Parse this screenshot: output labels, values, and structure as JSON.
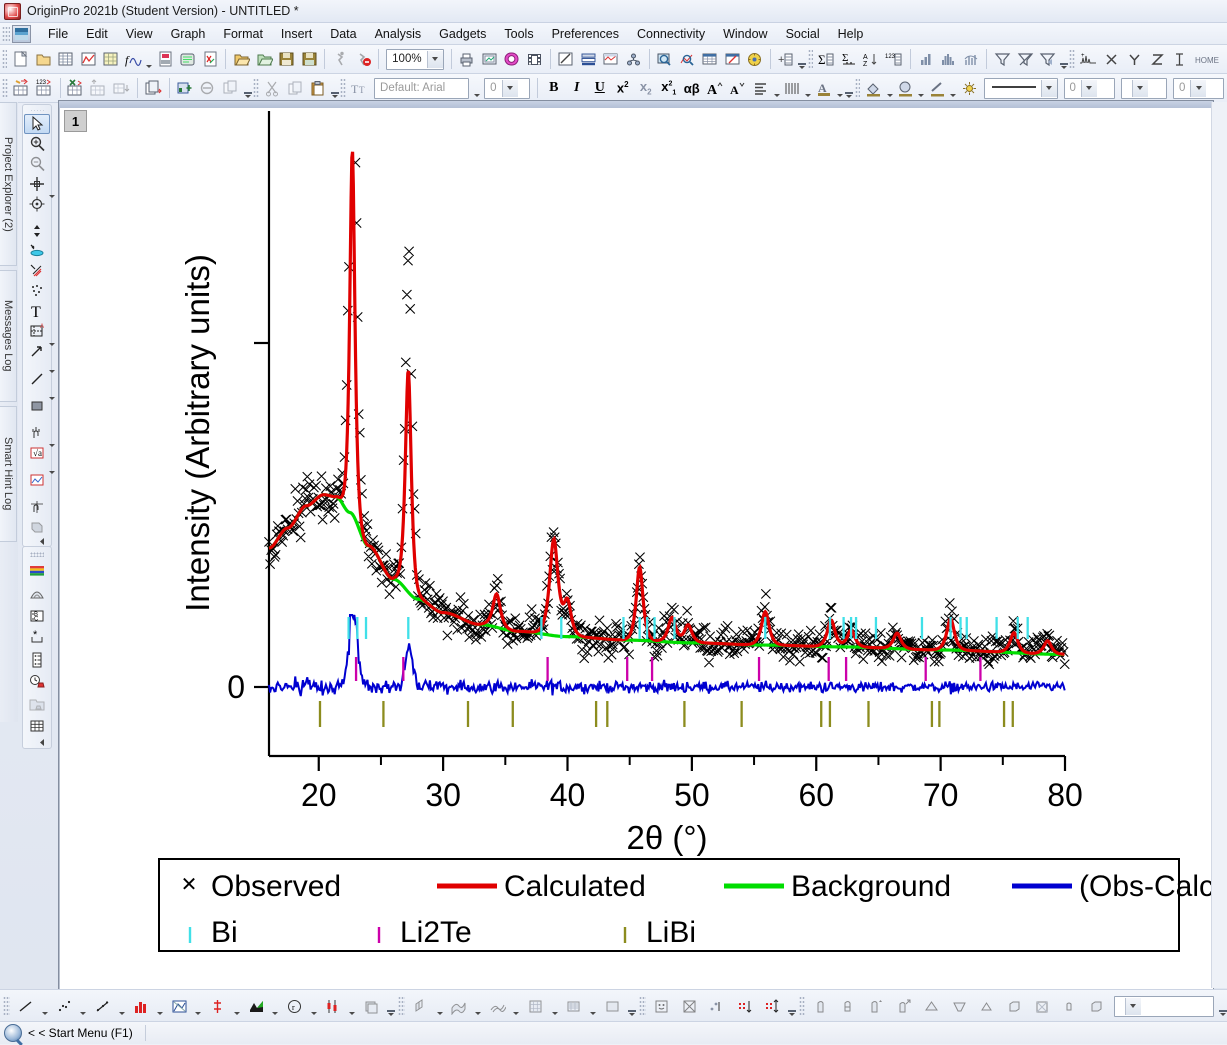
{
  "window": {
    "title": "OriginPro 2021b (Student Version) - UNTITLED *",
    "icon": "origin-logo-icon"
  },
  "menu": {
    "items": [
      {
        "label": "File"
      },
      {
        "label": "Edit"
      },
      {
        "label": "View"
      },
      {
        "label": "Graph"
      },
      {
        "label": "Format"
      },
      {
        "label": "Insert"
      },
      {
        "label": "Data"
      },
      {
        "label": "Analysis"
      },
      {
        "label": "Gadgets"
      },
      {
        "label": "Tools"
      },
      {
        "label": "Preferences"
      },
      {
        "label": "Connectivity"
      },
      {
        "label": "Window"
      },
      {
        "label": "Social"
      },
      {
        "label": "Help"
      }
    ]
  },
  "toolbar_standard": {
    "zoom_value": "100%",
    "buttons": [
      "new-project-icon",
      "new-folder-icon",
      "new-workbook-icon",
      "new-graph-icon",
      "new-matrix-icon",
      "new-function-plot-icon",
      "new-layout-icon",
      "new-notes-icon",
      "new-excel-icon",
      "open-icon",
      "open-excel-icon",
      "save-project-icon",
      "save-template-icon",
      "run-script-icon",
      "stop-script-icon",
      "print-icon",
      "print-preview-icon",
      "export-graph-icon",
      "movie-icon",
      "duplicate-icon",
      "merge-graph-icon",
      "extract-graph-icon",
      "layer-management-icon",
      "zoom-in-icon",
      "zoom-out-icon",
      "new-layout-table-icon",
      "edit-layer-icon",
      "theme-gallery-icon",
      "add-layer-icon",
      "sum-icon",
      "statistics-icon",
      "sort-icon",
      "count-icon",
      "column-chart-icon",
      "histogram-icon",
      "distribution-icon",
      "filter-icon",
      "remove-filter-icon",
      "reapply-filter-icon",
      "peak-analyzer-icon",
      "x-function-icon",
      "y-function-icon",
      "z-function-icon",
      "error-bar-icon",
      "home-icon"
    ]
  },
  "toolbar_format": {
    "font_name": "Default: Arial",
    "font_size": "0",
    "line_width_value": "0",
    "line_style_value": "0",
    "buttons": [
      "text-tool-icon",
      "bold-icon",
      "italic-icon",
      "underline-icon",
      "superscript-icon",
      "subscript-icon",
      "super-sub-icon",
      "greek-icon",
      "increase-font-icon",
      "decrease-font-icon",
      "align-icon",
      "line-pattern-icon",
      "font-color-icon",
      "fill-color-icon",
      "pattern-color-icon",
      "line-color-icon",
      "lighting-icon"
    ]
  },
  "toolbar_graph2": {
    "buttons": [
      "new-column-icon",
      "new-row-icon",
      "add-sheet-icon",
      "add-col-icon",
      "add-table-icon",
      "copy-page-icon",
      "add-plot-icon",
      "mask-icon",
      "duplicate-sheet-icon",
      "cut-icon",
      "copy-icon",
      "paste-icon"
    ]
  },
  "left_dock": {
    "tabs": [
      {
        "label": "Project Explorer (2)",
        "name": "project-explorer-tab"
      },
      {
        "label": "Messages Log",
        "name": "messages-log-tab"
      },
      {
        "label": "Smart Hint Log",
        "name": "smart-hint-log-tab"
      }
    ]
  },
  "tools_palette": {
    "items": [
      {
        "name": "pointer-tool",
        "selected": true
      },
      {
        "name": "zoom-in-tool",
        "selected": false
      },
      {
        "name": "zoom-out-tool",
        "selected": false
      },
      {
        "name": "screen-reader-tool",
        "selected": false
      },
      {
        "name": "data-reader-tool",
        "selected": false
      },
      {
        "name": "data-selector-tool",
        "selected": false
      },
      {
        "name": "data-highlighter-tool",
        "selected": false
      },
      {
        "name": "regional-mask-tool",
        "selected": false
      },
      {
        "name": "regional-data-select-tool",
        "selected": false
      },
      {
        "name": "draw-data-tool",
        "selected": false
      },
      {
        "name": "text-tool",
        "selected": false
      },
      {
        "name": "annotation-tool",
        "selected": false
      },
      {
        "name": "arrow-tool",
        "selected": false
      },
      {
        "name": "line-tool",
        "selected": false
      },
      {
        "name": "rectangle-tool",
        "selected": false
      },
      {
        "name": "scale-tool",
        "selected": false
      },
      {
        "name": "equation-tool",
        "selected": false
      },
      {
        "name": "graph-object-tool",
        "selected": false
      },
      {
        "name": "layer-drag-tool",
        "selected": false
      },
      {
        "name": "region-tool",
        "selected": false
      }
    ]
  },
  "style_palette": {
    "items": [
      {
        "name": "color-palette-tool"
      },
      {
        "name": "colormap-tool"
      },
      {
        "name": "rename-tool"
      },
      {
        "name": "asterisk-tool"
      },
      {
        "name": "table-style-tool"
      },
      {
        "name": "clock-stamp-tool"
      },
      {
        "name": "folder-export-tool"
      },
      {
        "name": "grid-tool"
      }
    ]
  },
  "graph": {
    "layer_label": "1"
  },
  "bottom_toolbar": {
    "groups": [
      [
        "line-plot-icon",
        "scatter-plot-icon",
        "line-symbol-icon",
        "column-plot-icon",
        "area-plot-icon",
        "high-low-close-icon",
        "fill-area-icon",
        "polar-plot-icon",
        "candlestick-icon",
        "stacked-icon"
      ],
      [
        "3d-bar-icon",
        "3d-surface-icon",
        "3d-waterfall-icon",
        "3d-matrix-icon",
        "contour-icon",
        "image-plot-icon"
      ],
      [
        "smiley-plot-icon",
        "ternary-plot-icon",
        "bubble-plot-icon",
        "vector-plot-icon",
        "xy-error-icon",
        "xyam-error-icon"
      ],
      [
        "3d-scatter-icon",
        "3d-trajectory-icon",
        "3d-vector-icon",
        "3d-vector-xyz-icon",
        "3d-cone-icon",
        "3d-funnel-icon",
        "3d-pyramid-icon",
        "3d-box-icon",
        "3d-wall-icon",
        "3d-parametric-icon",
        "3d-colormap-icon"
      ]
    ],
    "combo_value": ""
  },
  "status": {
    "text": "< < Start Menu (F1)",
    "icon": "start-menu-icon"
  },
  "chart_data": {
    "type": "line",
    "title": "",
    "xlabel": "2θ (°)",
    "ylabel": "Intensity (Arbitrary units)",
    "xlim": [
      16,
      80
    ],
    "ylim_label": "0",
    "xticks": [
      20,
      30,
      40,
      50,
      60,
      70,
      80
    ],
    "xminor_ticks": [
      25,
      35,
      45,
      55,
      65,
      75
    ],
    "yticks_labeled": [
      {
        "value": 0,
        "label": "0"
      }
    ],
    "grid": false,
    "legend_position": "below-axes",
    "series": [
      {
        "name": "Observed",
        "style": "scatter",
        "marker": "x",
        "color": "#000000"
      },
      {
        "name": "Calculated",
        "style": "line",
        "color": "#e00000"
      },
      {
        "name": "Background",
        "style": "line",
        "color": "#00dd00"
      },
      {
        "name": "(Obs-Calc)",
        "style": "line",
        "color": "#0000d0"
      },
      {
        "name": "Bi",
        "style": "ticks",
        "color": "#40e0e8"
      },
      {
        "name": "Li2Te",
        "style": "ticks",
        "color": "#cc00aa"
      },
      {
        "name": "LiBi",
        "style": "ticks",
        "color": "#8c8c1e"
      }
    ],
    "calculated_peaks": [
      {
        "two_theta": 22.7,
        "height": 0.82,
        "width": 0.3
      },
      {
        "two_theta": 27.2,
        "height": 0.5,
        "width": 0.35
      },
      {
        "two_theta": 34.3,
        "height": 0.075,
        "width": 0.45
      },
      {
        "two_theta": 38.9,
        "height": 0.215,
        "width": 0.5
      },
      {
        "two_theta": 40.0,
        "height": 0.075,
        "width": 0.45
      },
      {
        "two_theta": 45.8,
        "height": 0.165,
        "width": 0.4
      },
      {
        "two_theta": 48.4,
        "height": 0.055,
        "width": 0.45
      },
      {
        "two_theta": 49.7,
        "height": 0.04,
        "width": 0.45
      },
      {
        "two_theta": 55.9,
        "height": 0.075,
        "width": 0.45
      },
      {
        "two_theta": 61.2,
        "height": 0.06,
        "width": 0.45
      },
      {
        "two_theta": 62.8,
        "height": 0.038,
        "width": 0.45
      },
      {
        "two_theta": 66.5,
        "height": 0.035,
        "width": 0.45
      },
      {
        "two_theta": 70.8,
        "height": 0.07,
        "width": 0.45
      },
      {
        "two_theta": 75.9,
        "height": 0.045,
        "width": 0.45
      },
      {
        "two_theta": 78.6,
        "height": 0.03,
        "width": 0.45
      }
    ],
    "background_curve": [
      {
        "x": 16.0,
        "y": 0.265
      },
      {
        "x": 17.5,
        "y": 0.31
      },
      {
        "x": 19.0,
        "y": 0.36
      },
      {
        "x": 20.4,
        "y": 0.385
      },
      {
        "x": 21.4,
        "y": 0.38
      },
      {
        "x": 22.5,
        "y": 0.345
      },
      {
        "x": 24.0,
        "y": 0.27
      },
      {
        "x": 26.0,
        "y": 0.195
      },
      {
        "x": 28.0,
        "y": 0.15
      },
      {
        "x": 30.0,
        "y": 0.12
      },
      {
        "x": 33.0,
        "y": 0.093
      },
      {
        "x": 36.0,
        "y": 0.078
      },
      {
        "x": 40.0,
        "y": 0.066
      },
      {
        "x": 45.0,
        "y": 0.058
      },
      {
        "x": 50.0,
        "y": 0.052
      },
      {
        "x": 56.0,
        "y": 0.047
      },
      {
        "x": 62.0,
        "y": 0.043
      },
      {
        "x": 70.0,
        "y": 0.036
      },
      {
        "x": 80.0,
        "y": 0.026
      }
    ],
    "bragg_ticks": {
      "Bi": [
        22.4,
        23.1,
        23.8,
        27.2,
        37.9,
        39.5,
        44.5,
        45.8,
        46.4,
        47.0,
        48.6,
        55.9,
        61.1,
        62.2,
        62.8,
        63.2,
        64.8,
        68.5,
        70.8,
        71.6,
        72.1,
        74.5,
        76.2,
        77.0
      ],
      "Li2Te": [
        23.0,
        26.8,
        38.4,
        44.8,
        46.8,
        55.4,
        61.0,
        62.4,
        68.8,
        73.2
      ],
      "LiBi": [
        20.1,
        25.2,
        32.0,
        35.6,
        42.3,
        43.2,
        49.4,
        54.0,
        60.4,
        61.1,
        64.2,
        69.3,
        69.9,
        75.1,
        75.8
      ]
    }
  },
  "legend": {
    "row1": [
      {
        "label": "Observed",
        "marker": "x",
        "color": "#000000"
      },
      {
        "label": "Calculated",
        "marker": "line",
        "color": "#e00000"
      },
      {
        "label": "Background",
        "marker": "line",
        "color": "#00dd00"
      },
      {
        "label": "(Obs-Calc)",
        "marker": "line",
        "color": "#0000d0"
      }
    ],
    "row2": [
      {
        "label": "Bi",
        "marker": "tick",
        "color": "#40e0e8"
      },
      {
        "label": "Li2Te",
        "marker": "tick",
        "color": "#cc00aa"
      },
      {
        "label": "LiBi",
        "marker": "tick",
        "color": "#8c8c1e"
      }
    ]
  }
}
